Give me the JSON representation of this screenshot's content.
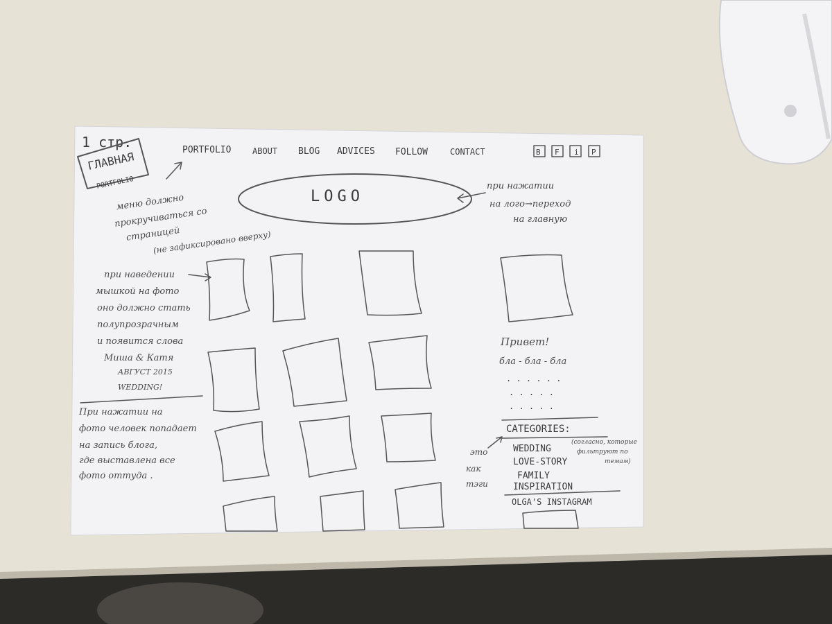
{
  "page_label": {
    "line1": "1 стр.",
    "line2": "ГЛАВНАЯ",
    "line3": "PORTFOLIO"
  },
  "nav": {
    "items": [
      "PORTFOLIO",
      "ABOUT",
      "BLOG",
      "ADVICES",
      "FOLLOW",
      "CONTACT"
    ],
    "social": [
      "B",
      "F",
      "i",
      "P"
    ]
  },
  "logo": {
    "text": "LOGO"
  },
  "notes": {
    "logo_click": [
      "при нажатии",
      "на лого→переход",
      "на главную"
    ],
    "menu": [
      "меню должно",
      "прокручиваться со",
      "страницей",
      "(не зафиксировано вверху)"
    ],
    "hover": [
      "при наведении",
      "мышкой на фото",
      "оно должно стать",
      "полупрозрачным",
      "и появится слова",
      "Миша & Катя",
      "АВГУСТ 2015",
      "WEDDING!"
    ],
    "click": [
      "При нажатии на",
      "фото человек попадает",
      "на запись блога,",
      "где выставлена все",
      "фото оттуда ."
    ],
    "tags": [
      "это",
      "как",
      "тэги"
    ],
    "categories_hint": [
      "(согласно, которые",
      "фильтруют по",
      "темам)"
    ]
  },
  "sidebar": {
    "greeting": "Привет!",
    "blah": "бла - бла - бла",
    "dots": [
      ". . . . . .",
      ". . . . .",
      ". . . . ."
    ],
    "categories_title": "CATEGORIES:",
    "categories": [
      "WEDDING",
      "LOVE-STORY",
      "FAMILY",
      "INSPIRATION"
    ],
    "instagram_title": "OLGA'S INSTAGRAM"
  },
  "colors": {
    "desk": "#e7e3d7",
    "paper": "#f3f3f5",
    "pencil": "#4a4a4a",
    "shadow": "#2b2a27"
  }
}
